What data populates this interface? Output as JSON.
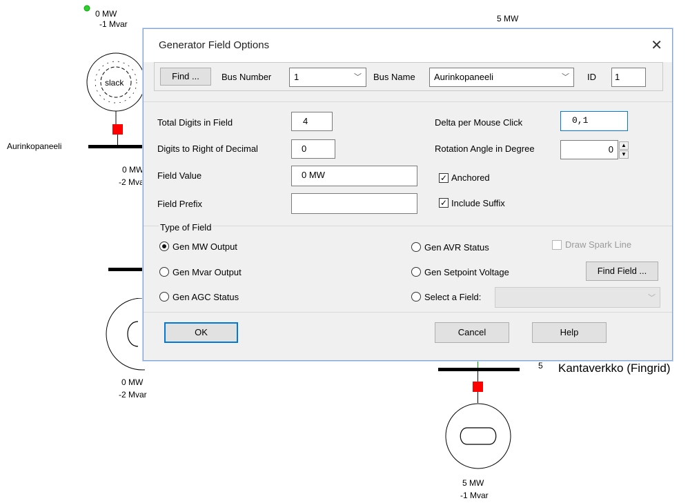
{
  "canvas": {
    "top_gen": {
      "mw": "0 MW",
      "mvar": "-1 Mvar",
      "symbol": "slack"
    },
    "bus1_name": "Aurinkopaneeli",
    "mid_gen": {
      "mw": "0 MW",
      "mvar": "-2 Mvar"
    },
    "left_gen": {
      "mw": "0 MW",
      "mvar": "-2 Mvar"
    },
    "right_top_mw": "5 MW",
    "right_bus": {
      "number": "5",
      "name": "Kantaverkko (Fingrid)"
    },
    "right_gen": {
      "mw": "5 MW",
      "mvar": "-1 Mvar"
    }
  },
  "dialog": {
    "title": "Generator Field Options",
    "close_icon": "close-icon",
    "find_label": "Find ...",
    "bus_number_label": "Bus Number",
    "bus_number_value": "1",
    "bus_name_label": "Bus Name",
    "bus_name_value": "Aurinkopaneeli",
    "id_label": "ID",
    "id_value": "1",
    "total_digits_label": "Total Digits in Field",
    "total_digits_value": "4",
    "digits_right_label": "Digits to Right of Decimal",
    "digits_right_value": "0",
    "field_value_label": "Field Value",
    "field_value_value": "0 MW",
    "field_prefix_label": "Field Prefix",
    "field_prefix_value": "",
    "delta_label": "Delta per Mouse Click",
    "delta_value": "0,1",
    "rotation_label": "Rotation Angle in Degree",
    "rotation_value": "0",
    "anchored_label": "Anchored",
    "include_suffix_label": "Include Suffix",
    "type_of_field_label": "Type of Field",
    "radios": {
      "gen_mw_output": "Gen MW Output",
      "gen_mvar_output": "Gen Mvar Output",
      "gen_agc_status": "Gen AGC Status",
      "gen_avr_status": "Gen AVR Status",
      "gen_setpoint_voltage": "Gen Setpoint Voltage",
      "select_a_field": "Select a Field:"
    },
    "draw_spark_line_label": "Draw Spark Line",
    "find_field_label": "Find Field ...",
    "ok_label": "OK",
    "cancel_label": "Cancel",
    "help_label": "Help"
  },
  "colors": {
    "accent": "#0078d7",
    "breaker": "#ff0000",
    "dialog_bg": "#f0f0f0"
  }
}
